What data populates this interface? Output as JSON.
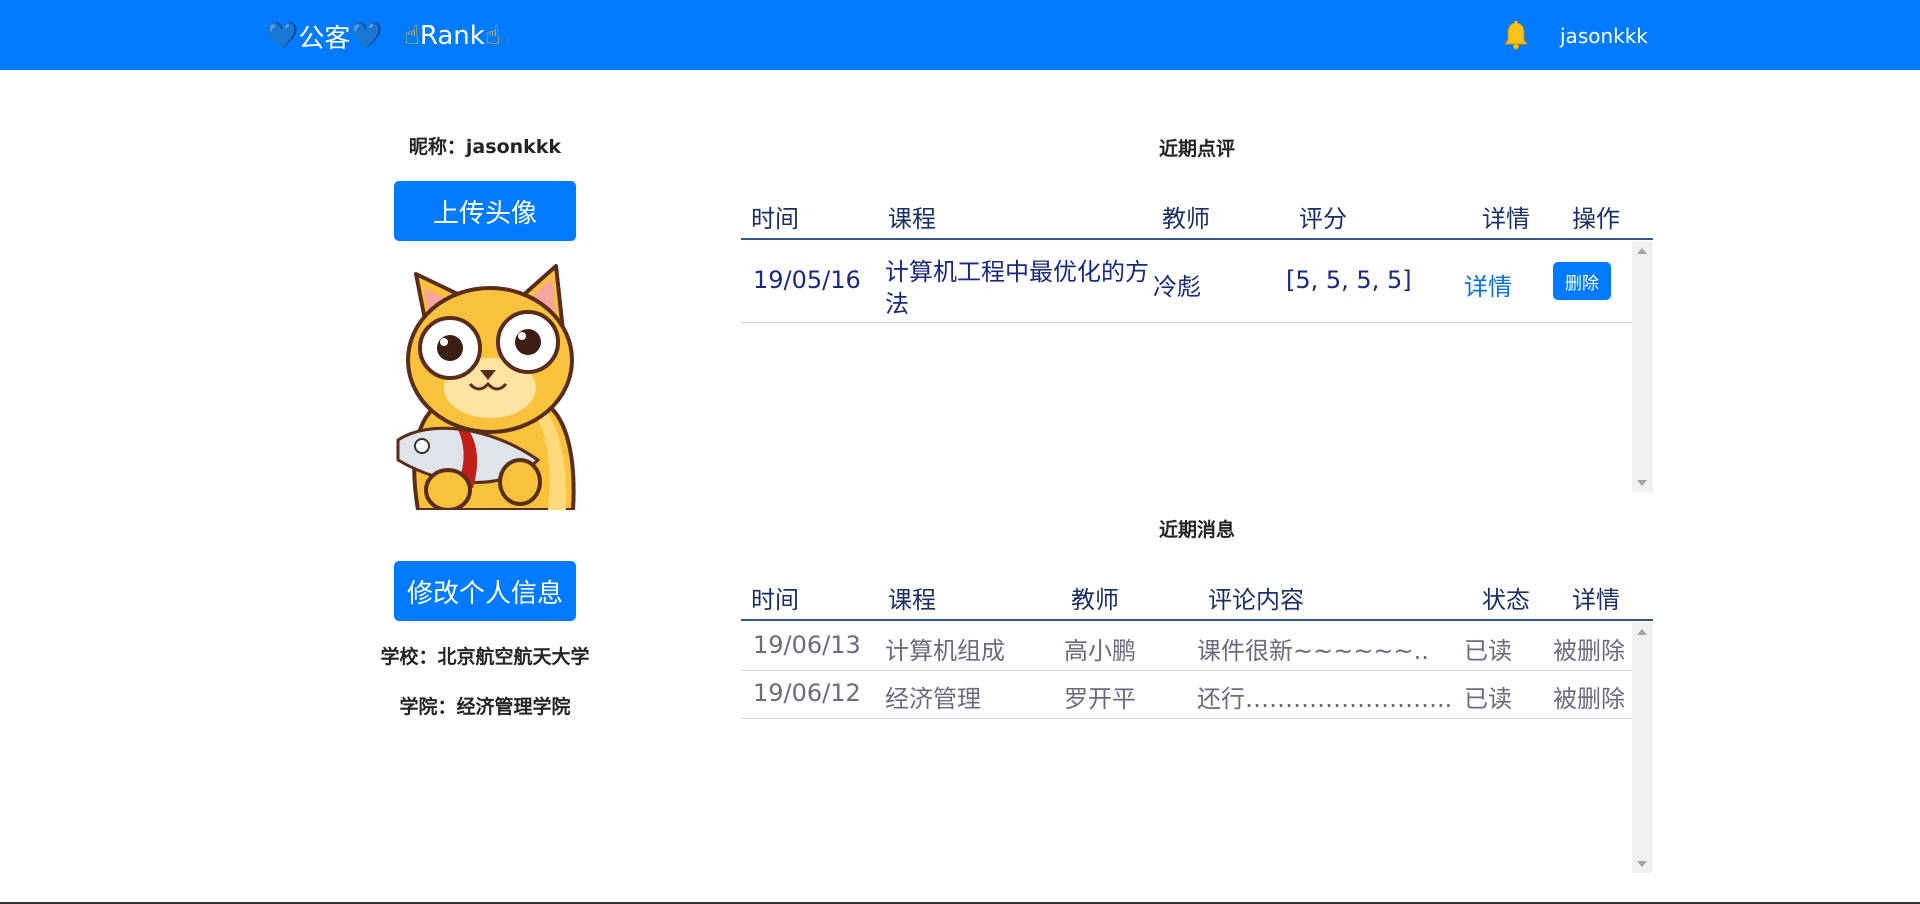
{
  "navbar": {
    "brand_heart": "💙",
    "brand_text": "公客",
    "rank_hand": "☝",
    "rank_text": "Rank",
    "username": "jasonkkk",
    "bell_icon": "bell-icon"
  },
  "profile": {
    "nickname": "昵称：jasonkkk",
    "upload_label": "上传头像",
    "edit_label": "修改个人信息",
    "school": "学校：北京航空航天大学",
    "college": "学院：经济管理学院"
  },
  "reviews": {
    "title": "近期点评",
    "headers": [
      "时间",
      "课程",
      "教师",
      "评分",
      "详情",
      "操作"
    ],
    "rows": [
      {
        "date": "19/05/16",
        "course_line1": "计算机工程中最优化的方",
        "course_line2": "法",
        "teacher": "冷彪",
        "score": "[5, 5, 5, 5]",
        "detail": "详情",
        "action": "删除"
      }
    ]
  },
  "messages": {
    "title": "近期消息",
    "headers": [
      "时间",
      "课程",
      "教师",
      "评论内容",
      "状态",
      "详情"
    ],
    "rows": [
      {
        "date": "19/06/13",
        "course": "计算机组成",
        "teacher": "高小鹏",
        "content": "课件很新~~~~~~..",
        "status": "已读",
        "detail": "被删除"
      },
      {
        "date": "19/06/12",
        "course": "经济管理",
        "teacher": "罗开平",
        "content": "还行……………………..",
        "status": "已读",
        "detail": "被删除"
      }
    ]
  },
  "colors": {
    "primary": "#007bff",
    "header_text": "#1a2f66",
    "review_text": "#1a2880",
    "message_text": "#6b6b80",
    "link": "#0a6fd6"
  }
}
